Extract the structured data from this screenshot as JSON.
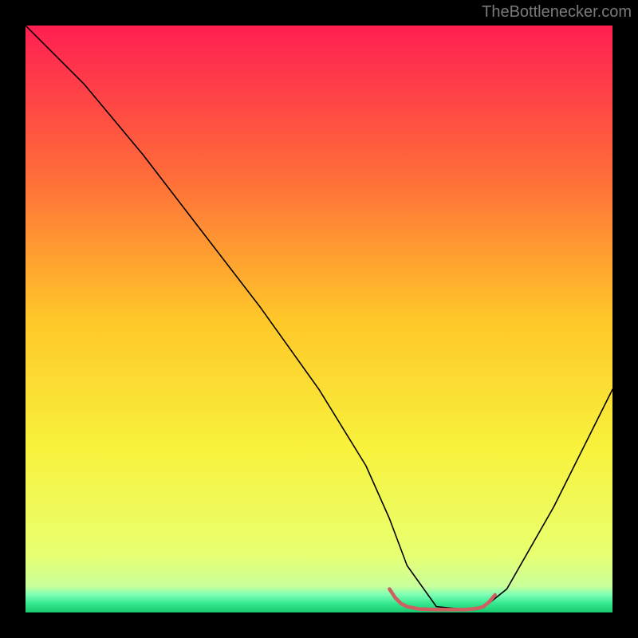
{
  "watermark": "TheBottlenecker.com",
  "chart_data": {
    "type": "line",
    "title": "",
    "xlabel": "",
    "ylabel": "",
    "xlim": [
      0,
      100
    ],
    "ylim": [
      0,
      100
    ],
    "grid": false,
    "background_gradient": {
      "type": "vertical",
      "stops": [
        {
          "offset": 0.0,
          "color": "#ff1f52"
        },
        {
          "offset": 0.25,
          "color": "#ff6a3a"
        },
        {
          "offset": 0.5,
          "color": "#ffc729"
        },
        {
          "offset": 0.72,
          "color": "#f8f23c"
        },
        {
          "offset": 0.9,
          "color": "#e8ff70"
        },
        {
          "offset": 0.955,
          "color": "#c9ff9a"
        },
        {
          "offset": 0.97,
          "color": "#7cffb4"
        },
        {
          "offset": 0.985,
          "color": "#33e78f"
        },
        {
          "offset": 1.0,
          "color": "#18c96e"
        }
      ]
    },
    "series": [
      {
        "name": "bottleneck-curve",
        "color": "#000000",
        "width": 1.6,
        "x": [
          0,
          4,
          10,
          20,
          30,
          40,
          50,
          58,
          62,
          65,
          70,
          75,
          78,
          82,
          90,
          100
        ],
        "y": [
          100,
          96,
          90,
          78,
          65,
          52,
          38,
          25,
          16,
          8,
          1,
          0.5,
          0.8,
          4,
          18,
          38
        ]
      }
    ],
    "highlight_segment": {
      "name": "optimal-zone",
      "color": "#cf6060",
      "width": 4.5,
      "x": [
        62,
        63,
        64,
        65,
        67,
        70,
        73,
        75,
        77,
        78,
        79,
        80
      ],
      "y": [
        4,
        2.5,
        1.5,
        1,
        0.6,
        0.5,
        0.5,
        0.5,
        0.7,
        1,
        1.8,
        3
      ]
    }
  }
}
